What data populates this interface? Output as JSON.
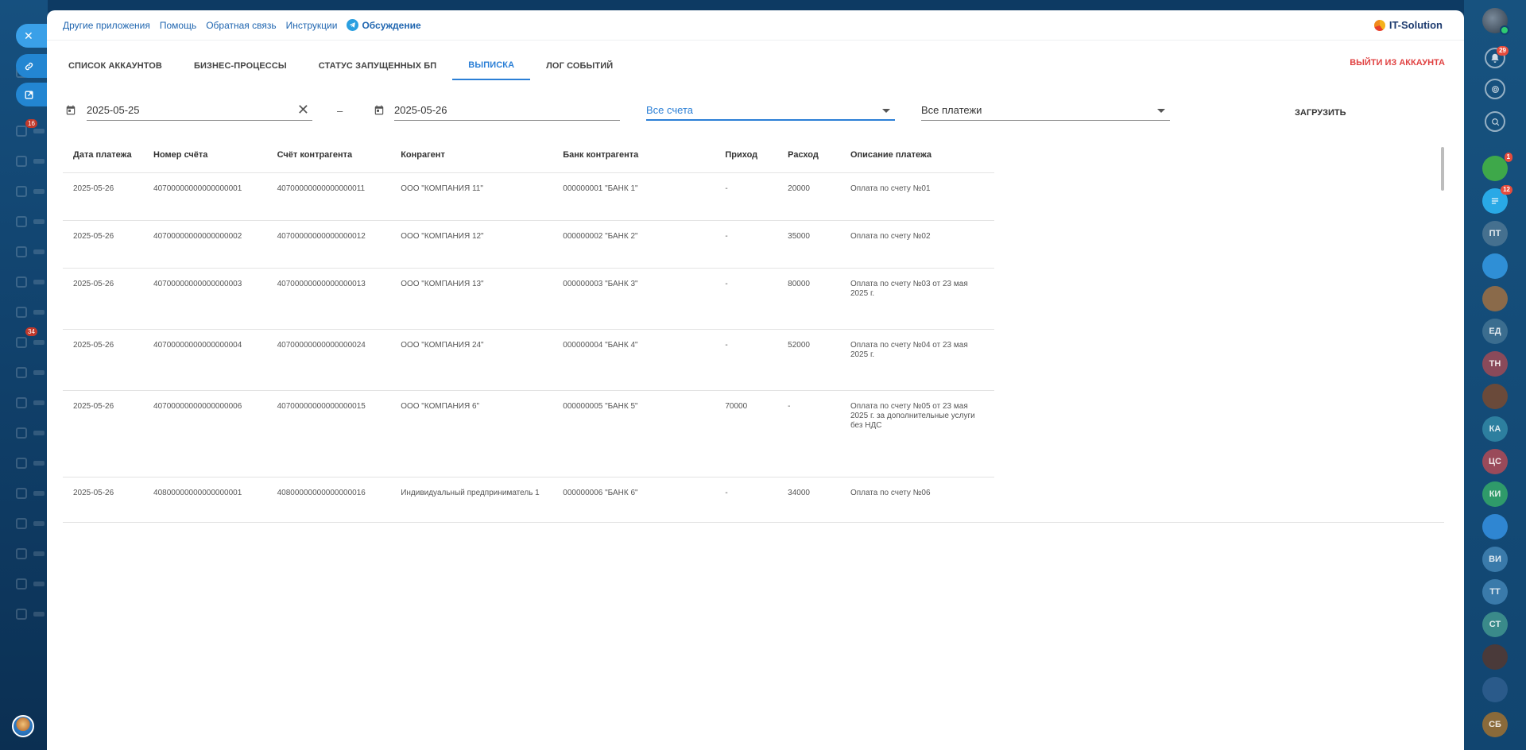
{
  "topbar": {
    "links": [
      "Другие приложения",
      "Помощь",
      "Обратная связь",
      "Инструкции"
    ],
    "telegram_label": "Обсуждение",
    "logo": "IT-Solution"
  },
  "tabs": [
    {
      "label": "Список аккаунтов",
      "active": false
    },
    {
      "label": "Бизнес-процессы",
      "active": false
    },
    {
      "label": "Статус запущенных БП",
      "active": false
    },
    {
      "label": "Выписка",
      "active": true
    },
    {
      "label": "Лог событий",
      "active": false
    }
  ],
  "logout_label": "Выйти из аккаунта",
  "filters": {
    "date_from": "2025-05-25",
    "date_to": "2025-05-26",
    "dash": "–",
    "accounts_select": "Все счета",
    "payments_select": "Все платежи",
    "load_label": "Загрузить"
  },
  "table": {
    "headers": [
      "Дата платежа",
      "Номер счёта",
      "Счёт контрагента",
      "Конрагент",
      "Банк контрагента",
      "Приход",
      "Расход",
      "Описание платежа"
    ],
    "rows": [
      [
        "2025-05-26",
        "40700000000000000001",
        "40700000000000000011",
        "ООО \"КОМПАНИЯ 11\"",
        "000000001 \"БАНК 1\"",
        "-",
        "20000",
        "Оплата по счету №01"
      ],
      [
        "2025-05-26",
        "40700000000000000002",
        "40700000000000000012",
        "ООО \"КОМПАНИЯ 12\"",
        "000000002 \"БАНК 2\"",
        "-",
        "35000",
        "Оплата по счету №02"
      ],
      [
        "2025-05-26",
        "40700000000000000003",
        "40700000000000000013",
        "ООО \"КОМПАНИЯ 13\"",
        "000000003 \"БАНК 3\"",
        "-",
        "80000",
        "Оплата по счету №03 от 23 мая 2025 г."
      ],
      [
        "2025-05-26",
        "40700000000000000004",
        "40700000000000000024",
        "ООО \"КОМПАНИЯ 24\"",
        "000000004 \"БАНК 4\"",
        "-",
        "52000",
        "Оплата по счету №04 от 23 мая 2025 г."
      ],
      [
        "2025-05-26",
        "40700000000000000006",
        "40700000000000000015",
        "ООО \"КОМПАНИЯ 6\"",
        "000000005 \"БАНК 5\"",
        "70000",
        "-",
        "Оплата по счету №05 от 23 мая 2025 г. за дополнительные услуги без НДС"
      ],
      [
        "2025-05-26",
        "40800000000000000001",
        "40800000000000000016",
        "Индивидуальный предприниматель 1",
        "000000006 \"БАНК 6\"",
        "-",
        "34000",
        "Оплата по счету №06"
      ]
    ]
  },
  "left_badges": [
    "16",
    "34"
  ],
  "right_sidebar": {
    "notif_count": "29",
    "chat_badges": [
      "1",
      "12"
    ],
    "avatars": [
      "ПТ",
      "ЕД",
      "ТН",
      "КА",
      "ЦС",
      "КИ",
      "ВИ",
      "ТТ",
      "СТ",
      "СБ"
    ]
  },
  "colors": {
    "accent": "#2b7fd6",
    "logout": "#e04242",
    "link": "#2066b0"
  }
}
